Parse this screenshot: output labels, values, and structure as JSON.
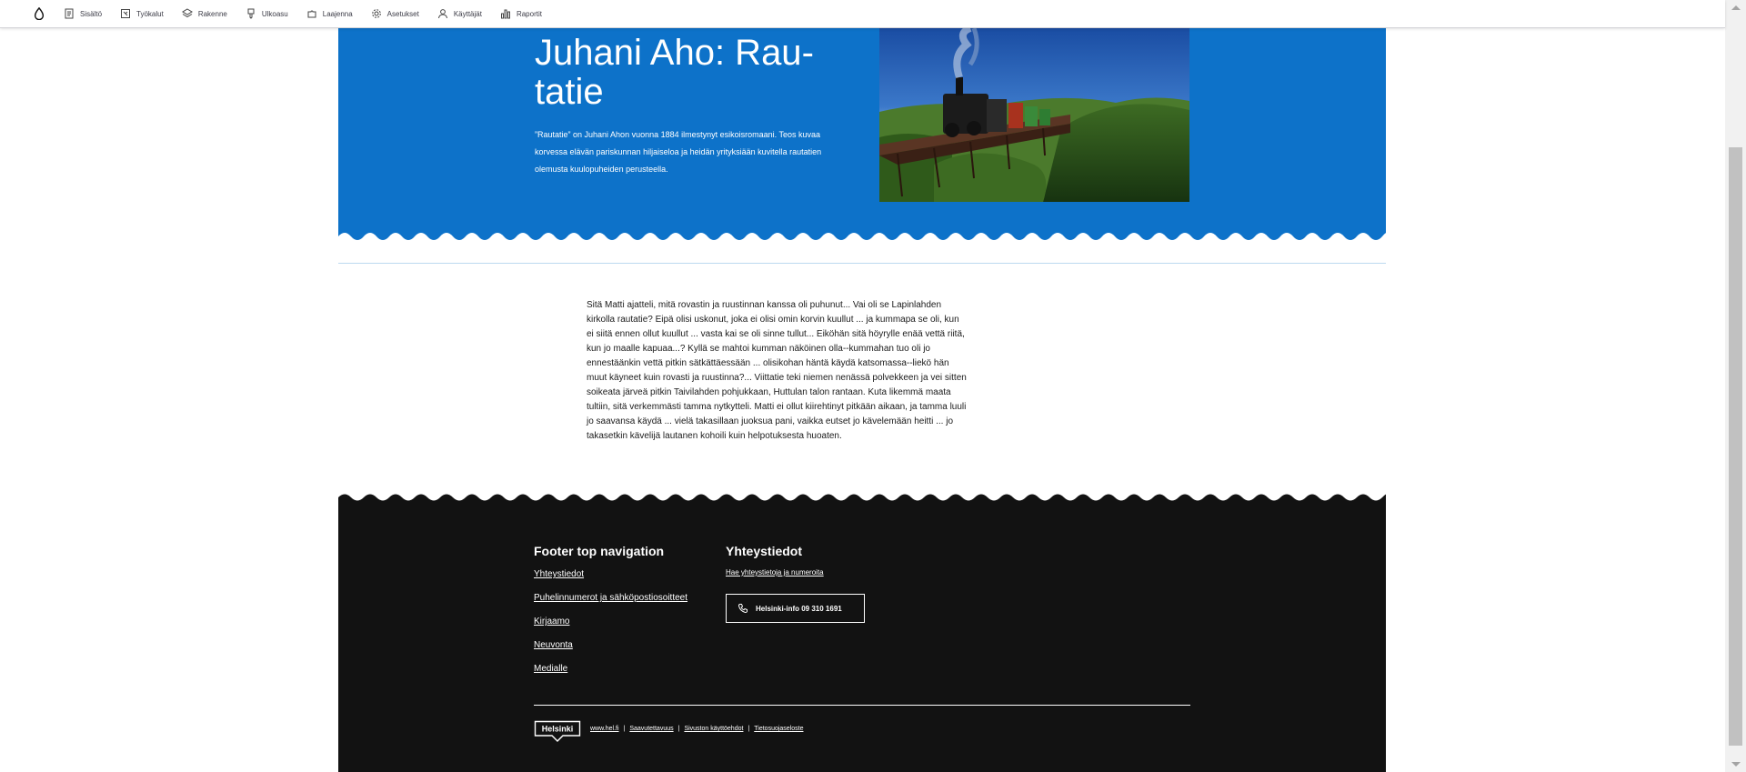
{
  "toolbar": {
    "items": [
      {
        "label": "Sisältö",
        "icon": "document-icon"
      },
      {
        "label": "Työkalut",
        "icon": "tools-icon"
      },
      {
        "label": "Rakenne",
        "icon": "layers-icon"
      },
      {
        "label": "Ulkoasu",
        "icon": "brush-icon"
      },
      {
        "label": "Laajenna",
        "icon": "puzzle-icon"
      },
      {
        "label": "Asetukset",
        "icon": "gear-icon"
      },
      {
        "label": "Käyttäjät",
        "icon": "person-icon"
      },
      {
        "label": "Raportit",
        "icon": "bar-chart-icon"
      }
    ]
  },
  "hero": {
    "title": "Juhani Aho: Rau­tatie",
    "lead": "”Rautatie” on Juhani Ahon vuonna 1884 ilmestynyt esikoisromaani. Teos kuvaa korvessa elävän pariskunnan hiljaiseloa ja heidän yrityksiään kuvitella rautatien olemusta kuulopuheiden perusteella.",
    "background_color": "#0d72c9"
  },
  "body_text": "Sitä Matti ajatteli, mitä rovastin ja ruustinnan kanssa oli puhunut... Vai oli se Lapinlahden kirkolla rautatie? Eipä olisi uskonut, joka ei olisi omin korvin kuullut ... ja kummapa se oli, kun ei siitä ennen ollut kuullut ... vasta kai se oli sinne tullut... Eiköhän sitä höyrylle enää vettä riitä, kun jo maalle kapuaa...? Kyllä se mahtoi kumman näköinen olla--kummahan tuo oli jo ennestäänkin vettä pitkin sätkättäessään ... olisikohan häntä käydä katsomassa--liekö hän muut käyneet kuin rovasti ja ruustinna?... Viittatie teki niemen nenässä polvekkeen ja vei sitten soikeata järveä pitkin Taivilahden pohjukkaan, Huttulan talon rantaan. Kuta likemmä maata tultiin, sitä verkemmästi tamma nytkytteli. Matti ei ollut kiirehtinyt pitkään aikaan, ja tamma luuli jo saavansa käydä ... vielä takasillaan juoksua pani, vaikka eutset jo kävelemään heitti ... jo takasetkin kävelijä lautanen kohoili kuin helpotuksesta huoaten.",
  "footer": {
    "nav_title": "Footer top navigation",
    "nav_links": [
      "Yhteystiedot",
      "Puhelinnumerot ja sähköpostiosoitteet",
      "Kirjaamo",
      "Neuvonta",
      "Medialle"
    ],
    "contact_title": "Yhteystiedot",
    "contact_link": "Hae yhteystietoja ja numeroita",
    "phone_button": "Helsinki-info 09 310 1691",
    "logo_text": "Helsinki",
    "bottom_links": [
      "www.hel.fi",
      "Saavutettavuus",
      "Sivuston käyttöehdot",
      "Tietosuojaseloste"
    ],
    "background_color": "#121212"
  }
}
